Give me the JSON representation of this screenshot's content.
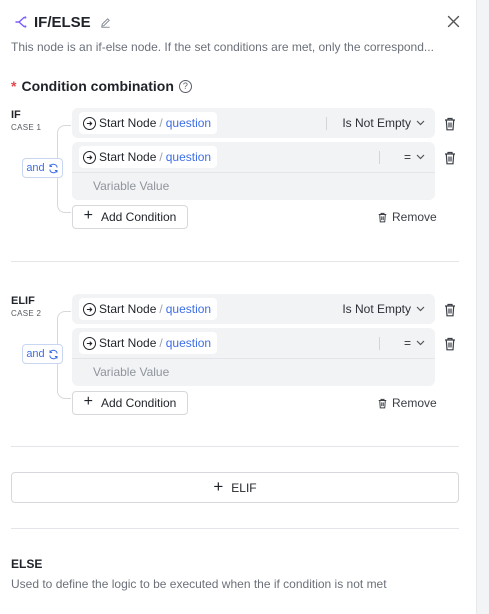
{
  "header": {
    "title": "IF/ELSE",
    "description": "This node is an if-else node. If the set conditions are met, only the correspond..."
  },
  "section": {
    "required_mark": "*",
    "title": "Condition combination",
    "help_glyph": "?"
  },
  "cases": [
    {
      "label": "IF",
      "sub": "CASE 1",
      "logic": "and",
      "conditions": [
        {
          "node": "Start Node",
          "separator": "/",
          "variable": "question",
          "operator": "Is Not Empty",
          "value_placeholder": ""
        },
        {
          "node": "Start Node",
          "separator": "/",
          "variable": "question",
          "operator": "=",
          "value_placeholder": "Variable Value"
        }
      ],
      "add_condition": "Add Condition",
      "remove": "Remove"
    },
    {
      "label": "ELIF",
      "sub": "CASE 2",
      "logic": "and",
      "conditions": [
        {
          "node": "Start Node",
          "separator": "/",
          "variable": "question",
          "operator": "Is Not Empty",
          "value_placeholder": ""
        },
        {
          "node": "Start Node",
          "separator": "/",
          "variable": "question",
          "operator": "=",
          "value_placeholder": "Variable Value"
        }
      ],
      "add_condition": "Add Condition",
      "remove": "Remove"
    }
  ],
  "elif_button": {
    "plus": "+",
    "label": "ELIF"
  },
  "else": {
    "title": "ELSE",
    "description": "Used to define the logic to be executed when the if condition is not met"
  },
  "icons": {
    "node": "if-else-branch-icon",
    "edit": "pencil-icon",
    "close": "close-icon",
    "help": "question-circle-icon",
    "trash": "trash-icon",
    "switch": "refresh-icon",
    "variable": "arrow-circle-icon",
    "dropdown": "chevron-down-icon"
  },
  "colors": {
    "accent": "#3e6ee6",
    "node_icon": "#7c5cfc",
    "required": "#e5484d"
  }
}
